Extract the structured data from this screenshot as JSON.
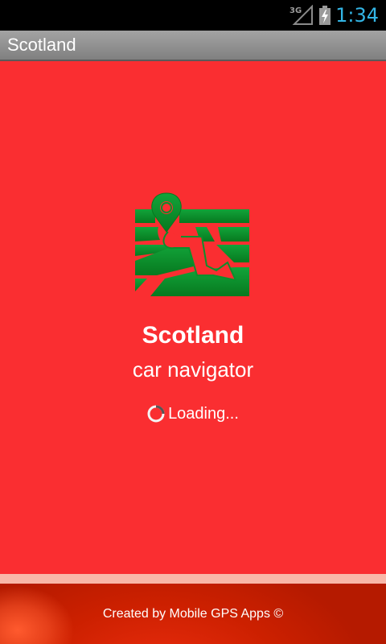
{
  "status_bar": {
    "network_type": "3G",
    "time": "1:34",
    "network_icon": "signal-icon",
    "battery_icon": "battery-charging-icon",
    "clock_color": "#33b5e5"
  },
  "title_bar": {
    "title": "Scotland"
  },
  "splash": {
    "logo_icon": "map-navigation-icon",
    "app_name": "Scotland",
    "subtitle": "car navigator",
    "loading_text": "Loading...",
    "spinner_icon": "loading-spinner-icon"
  },
  "footer": {
    "credit": "Created by Mobile GPS Apps ©"
  },
  "colors": {
    "background": "#fa2e31",
    "logo_green": "#0b8f2c",
    "footer": "#cc2000"
  }
}
